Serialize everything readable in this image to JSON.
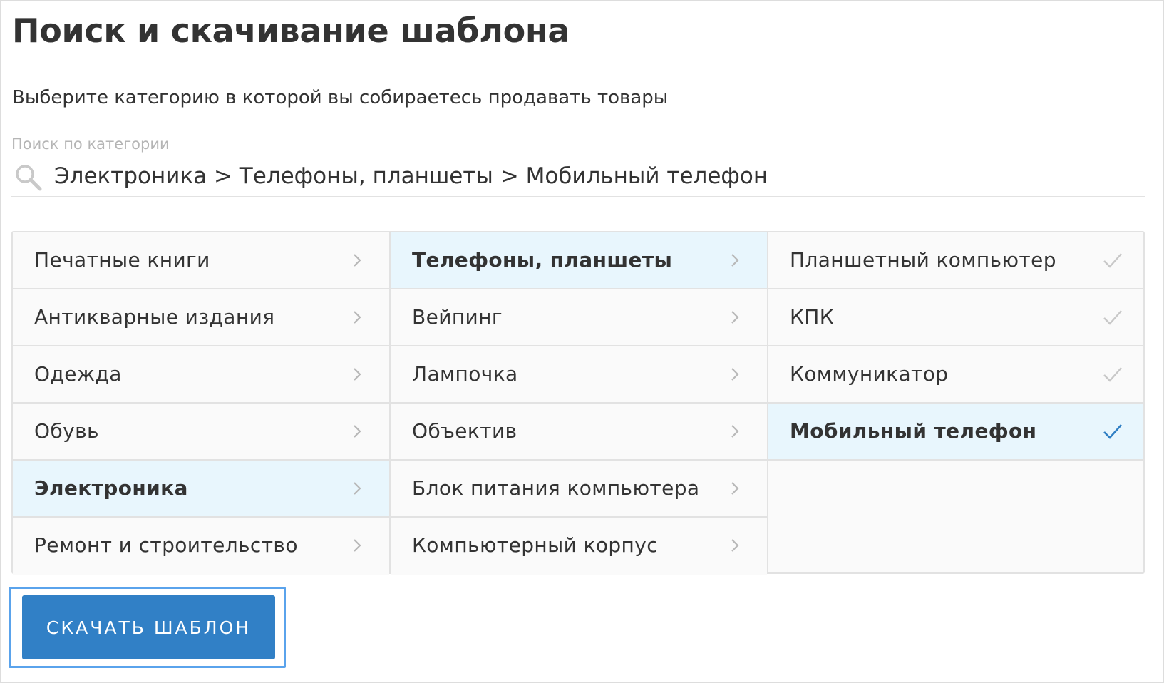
{
  "page": {
    "title": "Поиск и скачивание шаблона",
    "subtitle": "Выберите категорию в которой вы собираетесь продавать товары"
  },
  "search": {
    "label": "Поиск по категории",
    "value": "Электроника > Телефоны, планшеты > Мобильный телефон",
    "icon": "search-icon"
  },
  "columns": [
    {
      "items": [
        {
          "label": "Печатные книги",
          "selected": false
        },
        {
          "label": "Антикварные издания",
          "selected": false
        },
        {
          "label": "Одежда",
          "selected": false
        },
        {
          "label": "Обувь",
          "selected": false
        },
        {
          "label": "Электроника",
          "selected": true
        },
        {
          "label": "Ремонт и строительство",
          "selected": false
        }
      ],
      "icon": "chevron-right-icon"
    },
    {
      "items": [
        {
          "label": "Телефоны, планшеты",
          "selected": true
        },
        {
          "label": "Вейпинг",
          "selected": false
        },
        {
          "label": "Лампочка",
          "selected": false
        },
        {
          "label": "Объектив",
          "selected": false
        },
        {
          "label": "Блок питания компьютера",
          "selected": false
        },
        {
          "label": "Компьютерный корпус",
          "selected": false
        }
      ],
      "icon": "chevron-right-icon"
    },
    {
      "items": [
        {
          "label": "Планшетный компьютер",
          "selected": false
        },
        {
          "label": "КПК",
          "selected": false
        },
        {
          "label": "Коммуникатор",
          "selected": false
        },
        {
          "label": "Мобильный телефон",
          "selected": true
        }
      ],
      "icon": "check-icon"
    }
  ],
  "download": {
    "label": "СКАЧАТЬ ШАБЛОН"
  },
  "colors": {
    "selected_bg": "#e8f6fd",
    "button_bg": "#3180c6",
    "focus_ring": "#5aa3ec",
    "check_selected": "#2f7fc4",
    "check_idle": "#c8c8c8",
    "chevron": "#b8b8b8"
  }
}
